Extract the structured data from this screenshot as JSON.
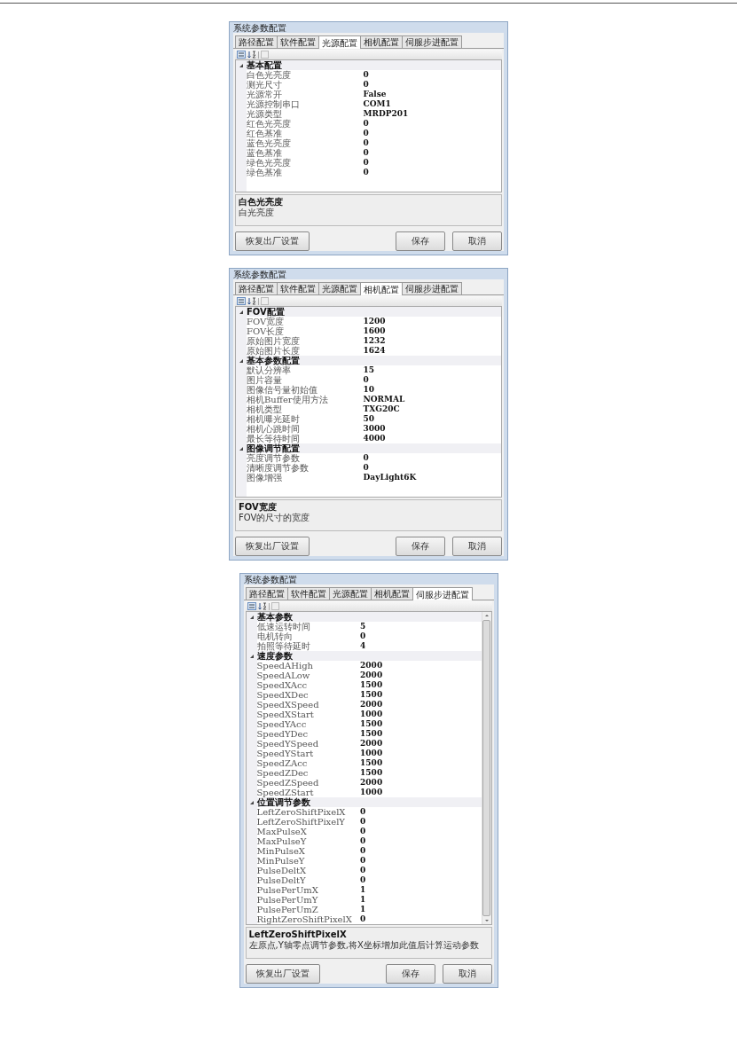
{
  "dialogs": [
    {
      "title": "系统参数配置",
      "scrollable": false,
      "tabs": [
        {
          "label": "路径配置",
          "selected": false
        },
        {
          "label": "软件配置",
          "selected": false
        },
        {
          "label": "光源配置",
          "selected": true
        },
        {
          "label": "相机配置",
          "selected": false
        },
        {
          "label": "伺服步进配置",
          "selected": false
        }
      ],
      "groups": [
        {
          "name": "基本配置",
          "expanded": true,
          "rows": [
            {
              "name": "白色光亮度",
              "value": "0"
            },
            {
              "name": "测光尺寸",
              "value": "0"
            },
            {
              "name": "光源常开",
              "value": "False"
            },
            {
              "name": "光源控制串口",
              "value": "COM1"
            },
            {
              "name": "光源类型",
              "value": "MRDP201"
            },
            {
              "name": "红色光亮度",
              "value": "0"
            },
            {
              "name": "红色基准",
              "value": "0"
            },
            {
              "name": "蓝色光亮度",
              "value": "0"
            },
            {
              "name": "蓝色基准",
              "value": "0"
            },
            {
              "name": "绿色光亮度",
              "value": "0"
            },
            {
              "name": "绿色基准",
              "value": "0"
            }
          ]
        }
      ],
      "description": {
        "title": "白色光亮度",
        "text": "白光亮度"
      },
      "buttons": [
        "恢复出厂设置",
        "保存",
        "取消"
      ]
    },
    {
      "title": "系统参数配置",
      "scrollable": false,
      "tabs": [
        {
          "label": "路径配置",
          "selected": false
        },
        {
          "label": "软件配置",
          "selected": false
        },
        {
          "label": "光源配置",
          "selected": false
        },
        {
          "label": "相机配置",
          "selected": true
        },
        {
          "label": "伺服步进配置",
          "selected": false
        }
      ],
      "groups": [
        {
          "name": "FOV配置",
          "expanded": true,
          "rows": [
            {
              "name": "FOV宽度",
              "value": "1200"
            },
            {
              "name": "FOV长度",
              "value": "1600"
            },
            {
              "name": "原始图片宽度",
              "value": "1232"
            },
            {
              "name": "原始图片长度",
              "value": "1624"
            }
          ]
        },
        {
          "name": "基本参数配置",
          "expanded": true,
          "rows": [
            {
              "name": "默认分辨率",
              "value": "15"
            },
            {
              "name": "图片容量",
              "value": "0"
            },
            {
              "name": "图像信号量初始值",
              "value": "10"
            },
            {
              "name": "相机Buffer使用方法",
              "value": "NORMAL"
            },
            {
              "name": "相机类型",
              "value": "TXG20C"
            },
            {
              "name": "相机曝光延时",
              "value": "50"
            },
            {
              "name": "相机心跳时间",
              "value": "3000"
            },
            {
              "name": "最长等待时间",
              "value": "4000"
            }
          ]
        },
        {
          "name": "图像调节配置",
          "expanded": true,
          "rows": [
            {
              "name": "亮度调节参数",
              "value": "0"
            },
            {
              "name": "清晰度调节参数",
              "value": "0"
            },
            {
              "name": "图像增强",
              "value": "DayLight6K"
            }
          ]
        }
      ],
      "description": {
        "title": "FOV宽度",
        "text": "FOV的尺寸的宽度"
      },
      "buttons": [
        "恢复出厂设置",
        "保存",
        "取消"
      ]
    },
    {
      "title": "系统参数配置",
      "scrollable": true,
      "tabs": [
        {
          "label": "路径配置",
          "selected": false
        },
        {
          "label": "软件配置",
          "selected": false
        },
        {
          "label": "光源配置",
          "selected": false
        },
        {
          "label": "相机配置",
          "selected": false
        },
        {
          "label": "伺服步进配置",
          "selected": true
        }
      ],
      "groups": [
        {
          "name": "基本参数",
          "expanded": true,
          "rows": [
            {
              "name": "低速运转时间",
              "value": "5"
            },
            {
              "name": "电机转向",
              "value": "0"
            },
            {
              "name": "拍照等待延时",
              "value": "4"
            }
          ]
        },
        {
          "name": "速度参数",
          "expanded": true,
          "rows": [
            {
              "name": "SpeedAHigh",
              "value": "2000"
            },
            {
              "name": "SpeedALow",
              "value": "2000"
            },
            {
              "name": "SpeedXAcc",
              "value": "1500"
            },
            {
              "name": "SpeedXDec",
              "value": "1500"
            },
            {
              "name": "SpeedXSpeed",
              "value": "2000"
            },
            {
              "name": "SpeedXStart",
              "value": "1000"
            },
            {
              "name": "SpeedYAcc",
              "value": "1500"
            },
            {
              "name": "SpeedYDec",
              "value": "1500"
            },
            {
              "name": "SpeedYSpeed",
              "value": "2000"
            },
            {
              "name": "SpeedYStart",
              "value": "1000"
            },
            {
              "name": "SpeedZAcc",
              "value": "1500"
            },
            {
              "name": "SpeedZDec",
              "value": "1500"
            },
            {
              "name": "SpeedZSpeed",
              "value": "2000"
            },
            {
              "name": "SpeedZStart",
              "value": "1000"
            }
          ]
        },
        {
          "name": "位置调节参数",
          "expanded": true,
          "rows": [
            {
              "name": "LeftZeroShiftPixelX",
              "value": "0"
            },
            {
              "name": "LeftZeroShiftPixelY",
              "value": "0"
            },
            {
              "name": "MaxPulseX",
              "value": "0"
            },
            {
              "name": "MaxPulseY",
              "value": "0"
            },
            {
              "name": "MinPulseX",
              "value": "0"
            },
            {
              "name": "MinPulseY",
              "value": "0"
            },
            {
              "name": "PulseDeltX",
              "value": "0"
            },
            {
              "name": "PulseDeltY",
              "value": "0"
            },
            {
              "name": "PulsePerUmX",
              "value": "1"
            },
            {
              "name": "PulsePerUmY",
              "value": "1"
            },
            {
              "name": "PulsePerUmZ",
              "value": "1"
            },
            {
              "name": "RightZeroShiftPixelX",
              "value": "0"
            }
          ]
        }
      ],
      "description": {
        "title": "LeftZeroShiftPixelX",
        "text": "左原点,Y轴零点调节参数,将X坐标增加此值后计算运动参数"
      },
      "buttons": [
        "恢复出厂设置",
        "保存",
        "取消"
      ]
    }
  ]
}
